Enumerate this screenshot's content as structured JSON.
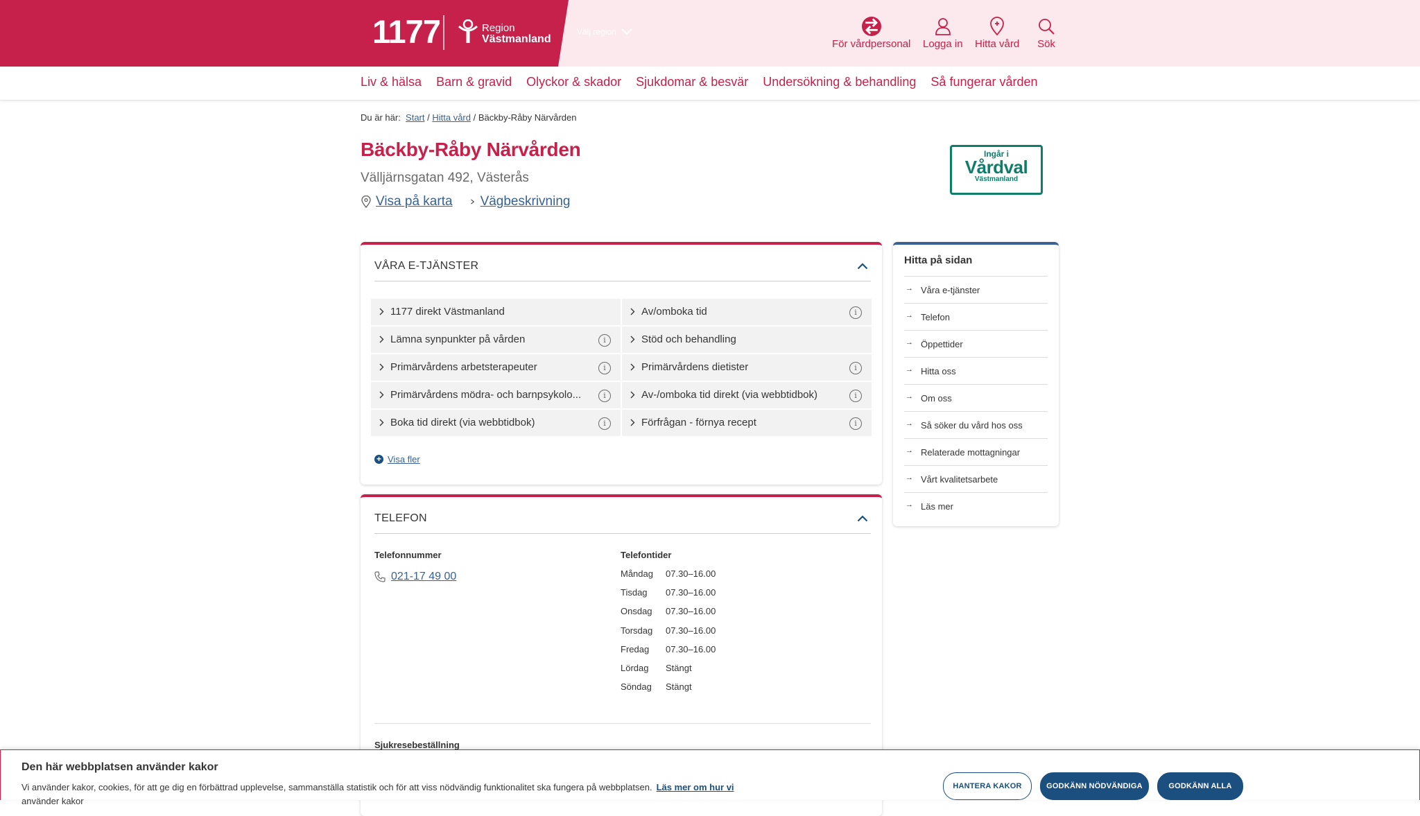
{
  "header": {
    "logo_text": "1177",
    "region_line1": "Region",
    "region_line2": "Västmanland",
    "region_selector": "Välj region",
    "items": [
      {
        "label": "För vårdpersonal",
        "icon": "arrows-swap-icon"
      },
      {
        "label": "Logga in",
        "icon": "user-icon"
      },
      {
        "label": "Hitta vård",
        "icon": "location-pin-icon"
      },
      {
        "label": "Sök",
        "icon": "search-icon"
      }
    ],
    "brand_color": "#c6214a"
  },
  "nav": {
    "items": [
      "Liv & hälsa",
      "Barn & gravid",
      "Olyckor & skador",
      "Sjukdomar & besvär",
      "Undersökning & behandling",
      "Så fungerar vården"
    ]
  },
  "breadcrumb": {
    "prefix": "Du är här:",
    "start": "Start",
    "sep1": " / ",
    "hitta": "Hitta vård",
    "sep2": " / ",
    "current": "Bäckby-Råby Närvården"
  },
  "clinic": {
    "name": "Bäckby-Råby Närvården",
    "address": "Välljärnsgatan 492, Västerås",
    "show_map": "Visa på karta",
    "directions": "Vägbeskrivning",
    "badge_line1": "Ingår i",
    "badge_line2": "Vårdval",
    "badge_line3": "Västmanland"
  },
  "eservices": {
    "heading": "VÅRA E-TJÄNSTER",
    "items": [
      {
        "label": "1177 direkt Västmanland",
        "info": false
      },
      {
        "label": "Av/omboka tid",
        "info": true
      },
      {
        "label": "Lämna synpunkter på vården",
        "info": true
      },
      {
        "label": "Stöd och behandling",
        "info": false
      },
      {
        "label": "Primärvårdens arbetsterapeuter",
        "info": true
      },
      {
        "label": "Primärvårdens dietister",
        "info": true
      },
      {
        "label": "Primärvårdens mödra- och barnpsykolo...",
        "info": true
      },
      {
        "label": "Av-/omboka tid direkt (via webbtidbok)",
        "info": true
      },
      {
        "label": "Boka tid direkt (via webbtidbok)",
        "info": true
      },
      {
        "label": "Förfrågan - förnya recept",
        "info": true
      }
    ],
    "info_glyph": "i",
    "show_more": "Visa fler"
  },
  "telefon": {
    "heading": "TELEFON",
    "number_label": "Telefonnummer",
    "number": "021-17 49 00",
    "hours_label": "Telefontider",
    "hours": [
      {
        "day": "Måndag",
        "time": "07.30–16.00"
      },
      {
        "day": "Tisdag",
        "time": "07.30–16.00"
      },
      {
        "day": "Onsdag",
        "time": "07.30–16.00"
      },
      {
        "day": "Torsdag",
        "time": "07.30–16.00"
      },
      {
        "day": "Fredag",
        "time": "07.30–16.00"
      },
      {
        "day": "Lördag",
        "time": "Stängt"
      },
      {
        "day": "Söndag",
        "time": "Stängt"
      }
    ],
    "sjukrese": "Sjukresebeställning"
  },
  "sidebar": {
    "heading": "Hitta på sidan",
    "arrow": "→",
    "items": [
      "Våra e-tjänster",
      "Telefon",
      "Öppettider",
      "Hitta oss",
      "Om oss",
      "Så söker du vård hos oss",
      "Relaterade mottagningar",
      "Vårt kvalitetsarbete",
      "Läs mer"
    ]
  },
  "cookie": {
    "title": "Den här webbplatsen använder kakor",
    "text": "Vi använder kakor, cookies, för att ge dig en förbättrad upplevelse, sammanställa statistik och för att viss nödvändig funktionalitet ska fungera på webbplatsen.",
    "link": "Läs mer om hur vi",
    "text2": "använder kakor",
    "btn_manage": "HANTERA KAKOR",
    "btn_necessary": "GODKÄNN NÖDVÄNDIGA",
    "btn_all": "GODKÄNN ALLA"
  }
}
